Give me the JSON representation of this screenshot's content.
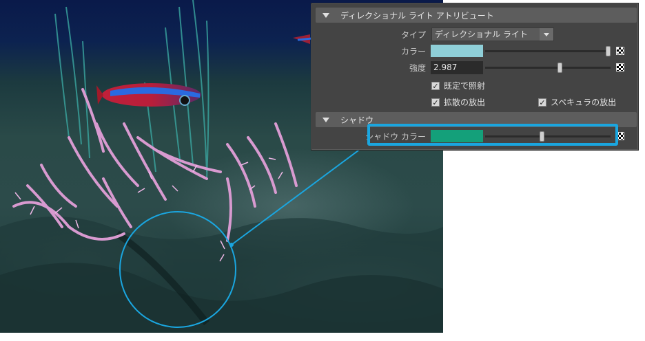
{
  "panel": {
    "section_directional": "ディレクショナル ライト アトリビュート",
    "type_label": "タイプ",
    "type_value": "ディレクショナル ライト",
    "color_label": "カラー",
    "color_value": "#8fcfd8",
    "color_slider_fraction": 1.0,
    "intensity_label": "強度",
    "intensity_value": "2.987",
    "intensity_slider_fraction": 0.6,
    "emit_diffuse_label": "既定で照射",
    "emit_diffuse_checked": true,
    "diffuse_label": "拡散の放出",
    "diffuse_checked": true,
    "specular_label": "スペキュラの放出",
    "specular_checked": true,
    "section_shadow": "シャドウ",
    "shadow_color_label": "シャドウ カラー",
    "shadow_color_value": "#14a07a",
    "shadow_slider_fraction": 0.45
  },
  "icons": {
    "collapse": "triangle-down-icon",
    "dropdown": "chevron-down-icon",
    "map": "checker-map-icon",
    "check": "check-icon"
  },
  "colors": {
    "highlight": "#1aa6e0",
    "panel_bg": "#444444",
    "header_bg": "#5d5d5d"
  }
}
